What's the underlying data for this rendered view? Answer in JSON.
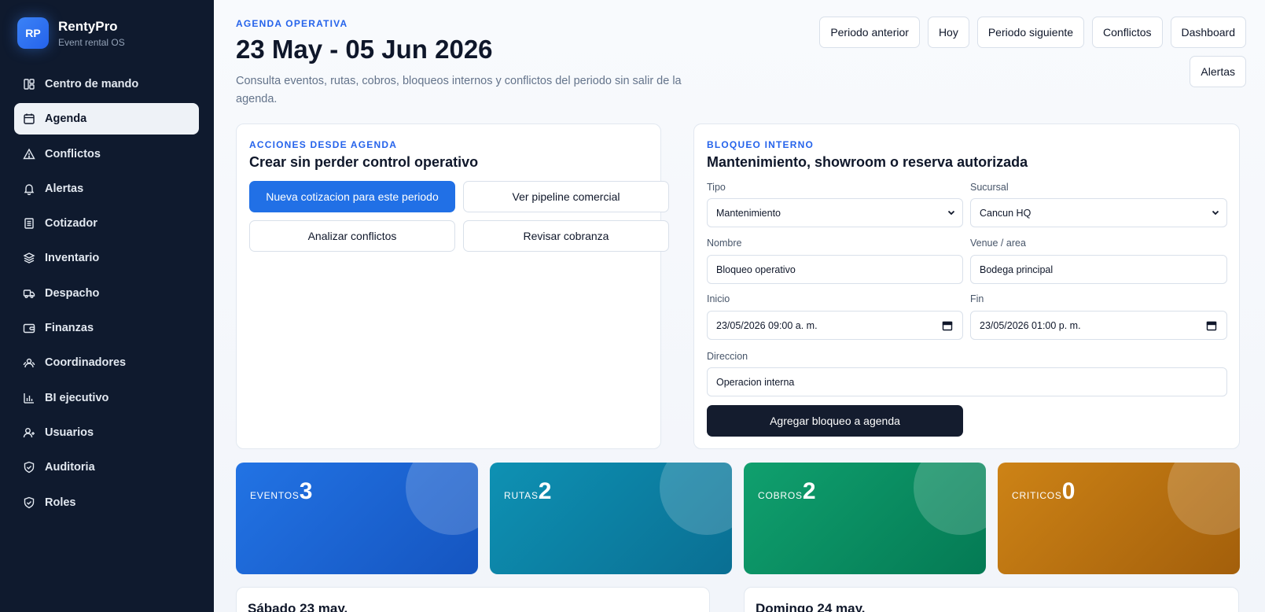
{
  "brand": {
    "logo": "RP",
    "name": "RentyPro",
    "subtitle": "Event rental OS"
  },
  "sidebar": {
    "items": [
      {
        "label": "Centro de mando",
        "icon": "dashboard-icon",
        "active": false
      },
      {
        "label": "Agenda",
        "icon": "calendar-icon",
        "active": true
      },
      {
        "label": "Conflictos",
        "icon": "warning-icon",
        "active": false
      },
      {
        "label": "Alertas",
        "icon": "bell-icon",
        "active": false
      },
      {
        "label": "Cotizador",
        "icon": "document-icon",
        "active": false
      },
      {
        "label": "Inventario",
        "icon": "layers-icon",
        "active": false
      },
      {
        "label": "Despacho",
        "icon": "truck-icon",
        "active": false
      },
      {
        "label": "Finanzas",
        "icon": "wallet-icon",
        "active": false
      },
      {
        "label": "Coordinadores",
        "icon": "users-icon",
        "active": false
      },
      {
        "label": "BI ejecutivo",
        "icon": "bar-chart-icon",
        "active": false
      },
      {
        "label": "Usuarios",
        "icon": "user-plus-icon",
        "active": false
      },
      {
        "label": "Auditoria",
        "icon": "shield-check-icon",
        "active": false
      },
      {
        "label": "Roles",
        "icon": "shield-check-icon",
        "active": false
      }
    ]
  },
  "header": {
    "eyebrow": "AGENDA OPERATIVA",
    "title": "23 May - 05 Jun 2026",
    "description": "Consulta eventos, rutas, cobros, bloqueos internos y conflictos del periodo sin salir de la agenda.",
    "actions": [
      "Periodo anterior",
      "Hoy",
      "Periodo siguiente",
      "Conflictos",
      "Dashboard",
      "Alertas"
    ]
  },
  "actions_card": {
    "eyebrow": "ACCIONES DESDE AGENDA",
    "title": "Crear sin perder control operativo",
    "buttons": {
      "new_quote": "Nueva cotizacion para este periodo",
      "pipeline": "Ver pipeline comercial",
      "conflicts": "Analizar conflictos",
      "collections": "Revisar cobranza"
    }
  },
  "block_card": {
    "eyebrow": "BLOQUEO INTERNO",
    "title": "Mantenimiento, showroom o reserva autorizada",
    "fields": {
      "tipo": {
        "label": "Tipo",
        "value": "Mantenimiento"
      },
      "sucursal": {
        "label": "Sucursal",
        "value": "Cancun HQ"
      },
      "nombre": {
        "label": "Nombre",
        "value": "Bloqueo operativo"
      },
      "venue": {
        "label": "Venue / area",
        "value": "Bodega principal"
      },
      "inicio": {
        "label": "Inicio",
        "value": "23/05/2026 09:00 a. m."
      },
      "fin": {
        "label": "Fin",
        "value": "23/05/2026 01:00 p. m."
      },
      "direccion": {
        "label": "Direccion",
        "value": "Operacion interna"
      }
    },
    "submit": "Agregar bloqueo a agenda"
  },
  "stats": [
    {
      "label": "EVENTOS",
      "value": 3,
      "color": "#2273e4"
    },
    {
      "label": "RUTAS",
      "value": 2,
      "color": "#0e91b3"
    },
    {
      "label": "COBROS",
      "value": 2,
      "color": "#10a06e"
    },
    {
      "label": "CRITICOS",
      "value": 0,
      "color": "#cd8316"
    }
  ],
  "days": [
    {
      "title": "Sábado 23 may."
    },
    {
      "title": "Domingo 24 may."
    }
  ]
}
